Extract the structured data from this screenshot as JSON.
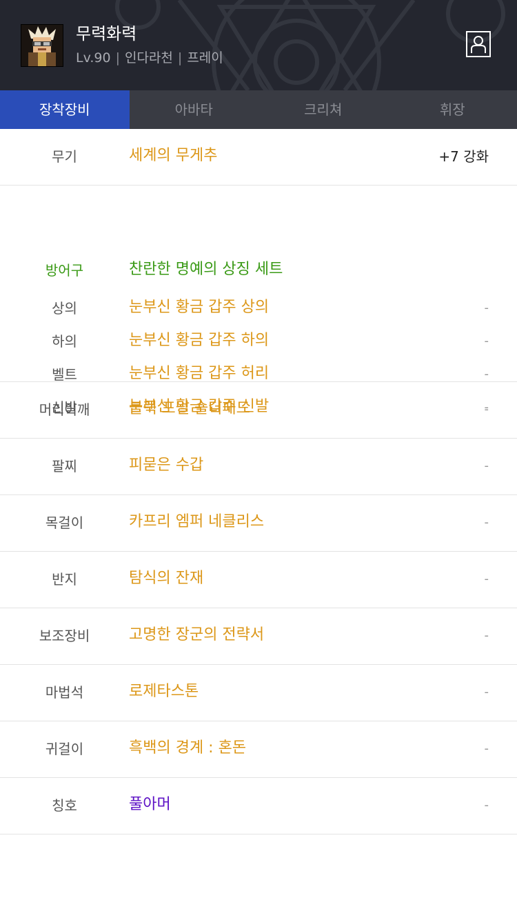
{
  "character": {
    "name": "무력화력",
    "level": "Lv.90",
    "server": "인다라천",
    "job": "프레이"
  },
  "tabs": [
    {
      "label": "장착장비",
      "active": true
    },
    {
      "label": "아바타",
      "active": false
    },
    {
      "label": "크리쳐",
      "active": false
    },
    {
      "label": "휘장",
      "active": false
    }
  ],
  "weapon": {
    "label": "무기",
    "value": "세계의 무게추",
    "extra": "+7 강화"
  },
  "armor": {
    "label": "방어구",
    "set_name": "찬란한 명예의 상징 세트",
    "items": [
      {
        "label": "상의",
        "value": "눈부신 황금 갑주 상의",
        "extra": "-"
      },
      {
        "label": "하의",
        "value": "눈부신 황금 갑주 하의",
        "extra": "-"
      },
      {
        "label": "벨트",
        "value": "눈부신 황금 갑주 허리",
        "extra": "-"
      },
      {
        "label": "신발",
        "value": "눈부신 황금 갑주 신발",
        "extra": "-"
      }
    ]
  },
  "slots": [
    {
      "label": "머리어깨",
      "value": "블랙 포멀 숄더패드",
      "extra": "-"
    },
    {
      "label": "팔찌",
      "value": "피묻은 수갑",
      "extra": "-"
    },
    {
      "label": "목걸이",
      "value": "카프리 엠퍼 네클리스",
      "extra": "-"
    },
    {
      "label": "반지",
      "value": "탐식의 잔재",
      "extra": "-"
    },
    {
      "label": "보조장비",
      "value": "고명한 장군의 전략서",
      "extra": "-"
    },
    {
      "label": "마법석",
      "value": "로제타스톤",
      "extra": "-"
    },
    {
      "label": "귀걸이",
      "value": "흑백의 경계 : 혼돈",
      "extra": "-"
    },
    {
      "label": "칭호",
      "value": "풀아머",
      "extra": "-"
    }
  ],
  "colors": {
    "header_bg": "#24262f",
    "tab_active": "#2a4db8",
    "item_orange": "#dc9718",
    "set_green": "#3a9a16",
    "title_purple": "#5c10c5"
  },
  "icons": [
    "profile-card-icon",
    "character-avatar"
  ]
}
